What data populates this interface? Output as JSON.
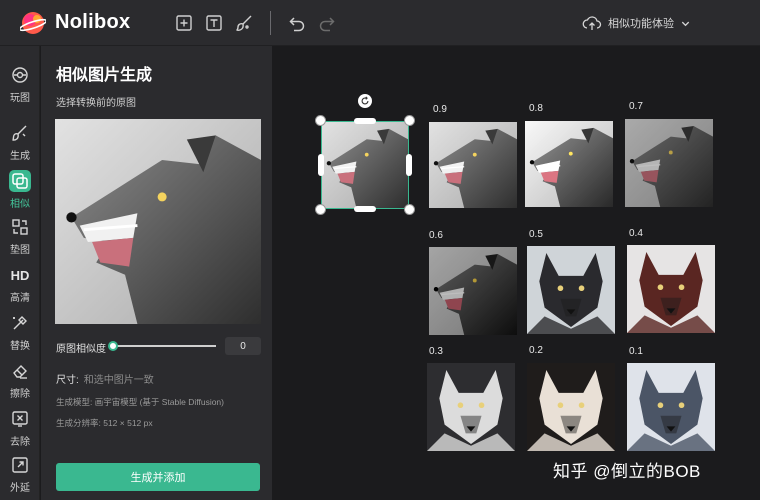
{
  "app": {
    "brand": "Nolibox"
  },
  "header": {
    "trial_label": "相似功能体验"
  },
  "rail": {
    "items": [
      {
        "label": "玩图",
        "icon": "play-icon"
      },
      {
        "label": "生成",
        "icon": "brush-icon"
      },
      {
        "label": "相似",
        "icon": "similar-icon",
        "active": true
      },
      {
        "label": "垫图",
        "icon": "pad-icon"
      },
      {
        "label": "高清",
        "icon": "hd-icon",
        "glyph": "HD"
      },
      {
        "label": "替换",
        "icon": "replace-icon"
      },
      {
        "label": "擦除",
        "icon": "eraser-icon"
      },
      {
        "label": "去除",
        "icon": "remove-icon"
      },
      {
        "label": "外延",
        "icon": "expand-icon"
      }
    ]
  },
  "panel": {
    "title": "相似图片生成",
    "subtitle": "选择转换前的原图",
    "similarity_label": "原图相似度",
    "similarity_value": "0",
    "size_label": "尺寸:",
    "size_value": "和选中图片一致",
    "model_text": "生成模型: 画宇宙模型 (基于 Stable Diffusion)",
    "resolution_text": "生成分辨率:   512 × 512 px",
    "generate_button": "生成并添加"
  },
  "canvas": {
    "results": [
      {
        "label": "0.9"
      },
      {
        "label": "0.8"
      },
      {
        "label": "0.7"
      },
      {
        "label": "0.6"
      },
      {
        "label": "0.5"
      },
      {
        "label": "0.4"
      },
      {
        "label": "0.3"
      },
      {
        "label": "0.2"
      },
      {
        "label": "0.1"
      }
    ]
  },
  "watermark": "知乎 @倒立的BOB",
  "colors": {
    "accent": "#3ab890",
    "topbar": "#2b2b2e",
    "canvas": "#1b1b1d"
  }
}
